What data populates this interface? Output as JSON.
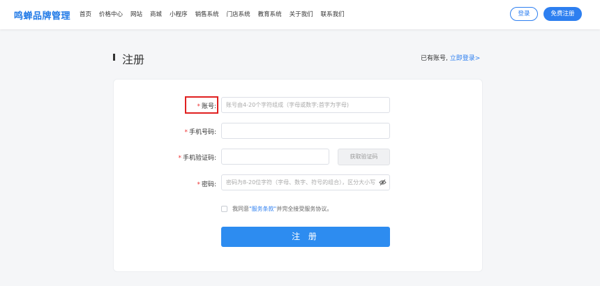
{
  "header": {
    "logo": "鸣蝉品牌管理",
    "nav": [
      "首页",
      "价格中心",
      "网站",
      "商城",
      "小程序",
      "销售系统",
      "门店系统",
      "教育系统",
      "关于我们",
      "联系我们"
    ],
    "login_label": "登录",
    "register_label": "免费注册"
  },
  "page": {
    "title": "注册",
    "have_account": "已有账号,",
    "login_link": "立即登录>"
  },
  "form": {
    "required_mark": "*",
    "account_label": "账号:",
    "account_placeholder": "账号由4-20个字符组成（字母或数字;首字为字母)",
    "phone_label": "手机号码:",
    "phone_value": "",
    "code_label": "手机验证码:",
    "code_value": "",
    "get_code_label": "获取验证码",
    "password_label": "密码:",
    "password_placeholder": "密码为8-20位字符（字母、数字、符号的组合），区分大小写",
    "agree_prefix": "我同意",
    "agree_link": "\"服务条款\"",
    "agree_suffix": "并完全接受服务协议。",
    "submit_label": "注 册"
  },
  "colors": {
    "accent": "#2d7ff0",
    "submit": "#2d8cf0",
    "highlight": "#e02020"
  }
}
